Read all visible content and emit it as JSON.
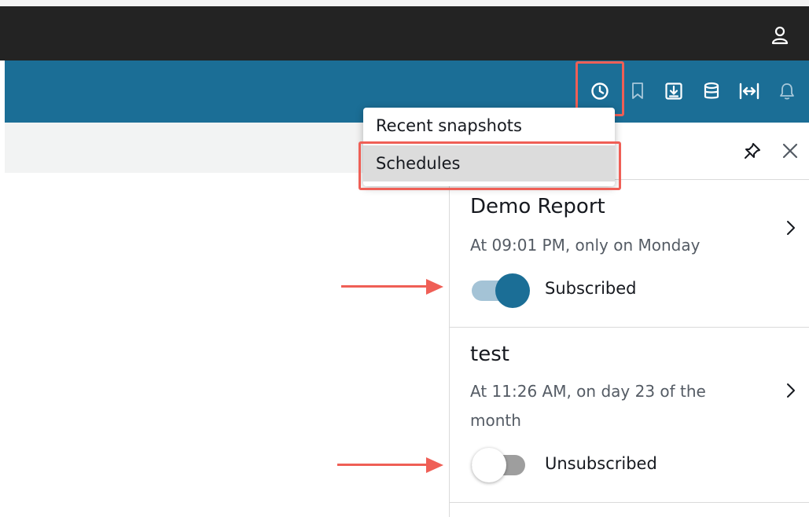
{
  "header": {
    "user_icon": "user-icon"
  },
  "toolbar": {
    "icons": [
      "clock-icon",
      "bookmark-icon",
      "download-icon",
      "database-icon",
      "fit-width-icon",
      "bell-icon"
    ]
  },
  "dropdown": {
    "items": [
      {
        "label": "Recent snapshots",
        "hovered": false
      },
      {
        "label": "Schedules",
        "hovered": true
      }
    ]
  },
  "panel": {
    "pin_icon": "pin-icon",
    "close_icon": "close-icon",
    "schedules": [
      {
        "title": "Demo Report",
        "description": "At 09:01 PM, only on Monday",
        "status": "Subscribed",
        "subscribed": true
      },
      {
        "title": "test",
        "description": "At 11:26 AM, on day 23 of the month",
        "status": "Unsubscribed",
        "subscribed": false
      }
    ]
  },
  "colors": {
    "topbar": "#232323",
    "toolbar": "#1b6e96",
    "highlight": "#ef5f56",
    "toggle_on_knob": "#1b6e96",
    "toggle_on_track": "#a4c3d6",
    "toggle_off_track": "#9e9e9e",
    "toggle_off_knob": "#ffffff"
  }
}
